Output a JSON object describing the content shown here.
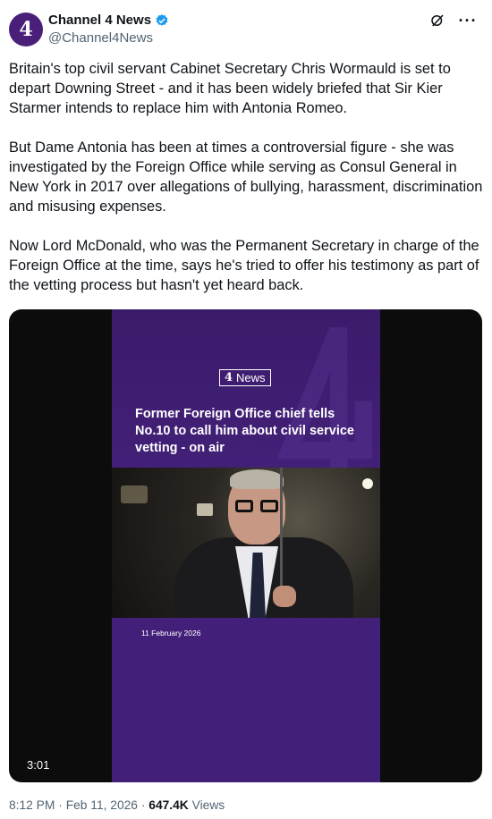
{
  "author": {
    "display_name": "Channel 4 News",
    "handle": "@Channel4News",
    "avatar_glyph": "4",
    "verified": true
  },
  "icons": {
    "grok": "grok-icon",
    "more": "more-icon"
  },
  "tweet": {
    "paragraphs": [
      "Britain's top civil servant Cabinet Secretary Chris Wormauld is set to depart Downing Street - and it has been widely briefed that Sir Kier Starmer intends to replace him with Antonia Romeo.",
      "But Dame Antonia has been at times a controversial figure - she was investigated by the Foreign Office while serving as Consul General in New York in 2017 over allegations of bullying, harassment, discrimination and misusing expenses.",
      "Now Lord McDonald, who was the Permanent Secretary in charge of the Foreign Office at the time, says he's tried to offer his testimony as part of the vetting process but hasn't yet heard back."
    ]
  },
  "video": {
    "badge_logo": "4",
    "badge_text": "News",
    "headline": "Former Foreign Office chief tells No.10 to call him about civil service vetting - on air",
    "date": "11 February 2026",
    "duration": "3:01"
  },
  "meta": {
    "time": "8:12 PM",
    "separator": "·",
    "date": "Feb 11, 2026",
    "views_count": "647.4K",
    "views_label": "Views"
  },
  "colors": {
    "brand_purple": "#42207a",
    "verified_blue": "#1d9bf0",
    "muted": "#536471"
  }
}
